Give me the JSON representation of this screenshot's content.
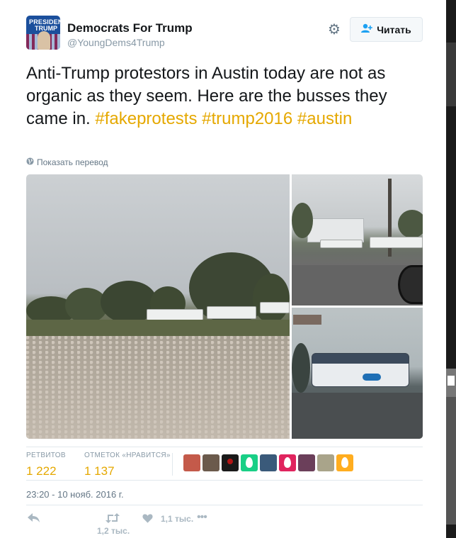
{
  "author": {
    "name": "Democrats For Trump",
    "handle": "@YoungDems4Trump",
    "avatar_text_1": "PRESIDENT",
    "avatar_text_2": "TRUMP"
  },
  "header": {
    "settings_icon": "gear-icon",
    "follow_label": "Читать",
    "follow_icon": "add-user-icon"
  },
  "tweet": {
    "text_parts": [
      {
        "text": "Anti-Trump protestors in Austin today are not as organic as they seem.  Here are the busses they came in.  ",
        "type": "plain"
      },
      {
        "text": "#fakeprotests",
        "type": "hashtag"
      },
      {
        "text": " ",
        "type": "plain"
      },
      {
        "text": "#trump2016",
        "type": "hashtag"
      },
      {
        "text": " ",
        "type": "plain"
      },
      {
        "text": "#austin",
        "type": "hashtag"
      }
    ],
    "translate_label": "Показать перевод",
    "translate_icon": "globe-icon"
  },
  "stats": {
    "retweets_label": "РЕТВИТОВ",
    "retweets_value": "1 222",
    "likes_label": "ОТМЕТОК «НРАВИТСЯ»",
    "likes_value": "1 137"
  },
  "timestamp": "23:20 - 10 нояб. 2016 г.",
  "actions": {
    "reply_icon": "reply-icon",
    "retweet_icon": "retweet-icon",
    "retweet_count": "1,2 тыс.",
    "like_icon": "heart-icon",
    "like_count": "1,1 тыс.",
    "more_icon": "more-icon"
  },
  "colors": {
    "accent": "#e5a800",
    "muted": "#8899a6",
    "border": "#e1e8ed",
    "text": "#14171a"
  }
}
